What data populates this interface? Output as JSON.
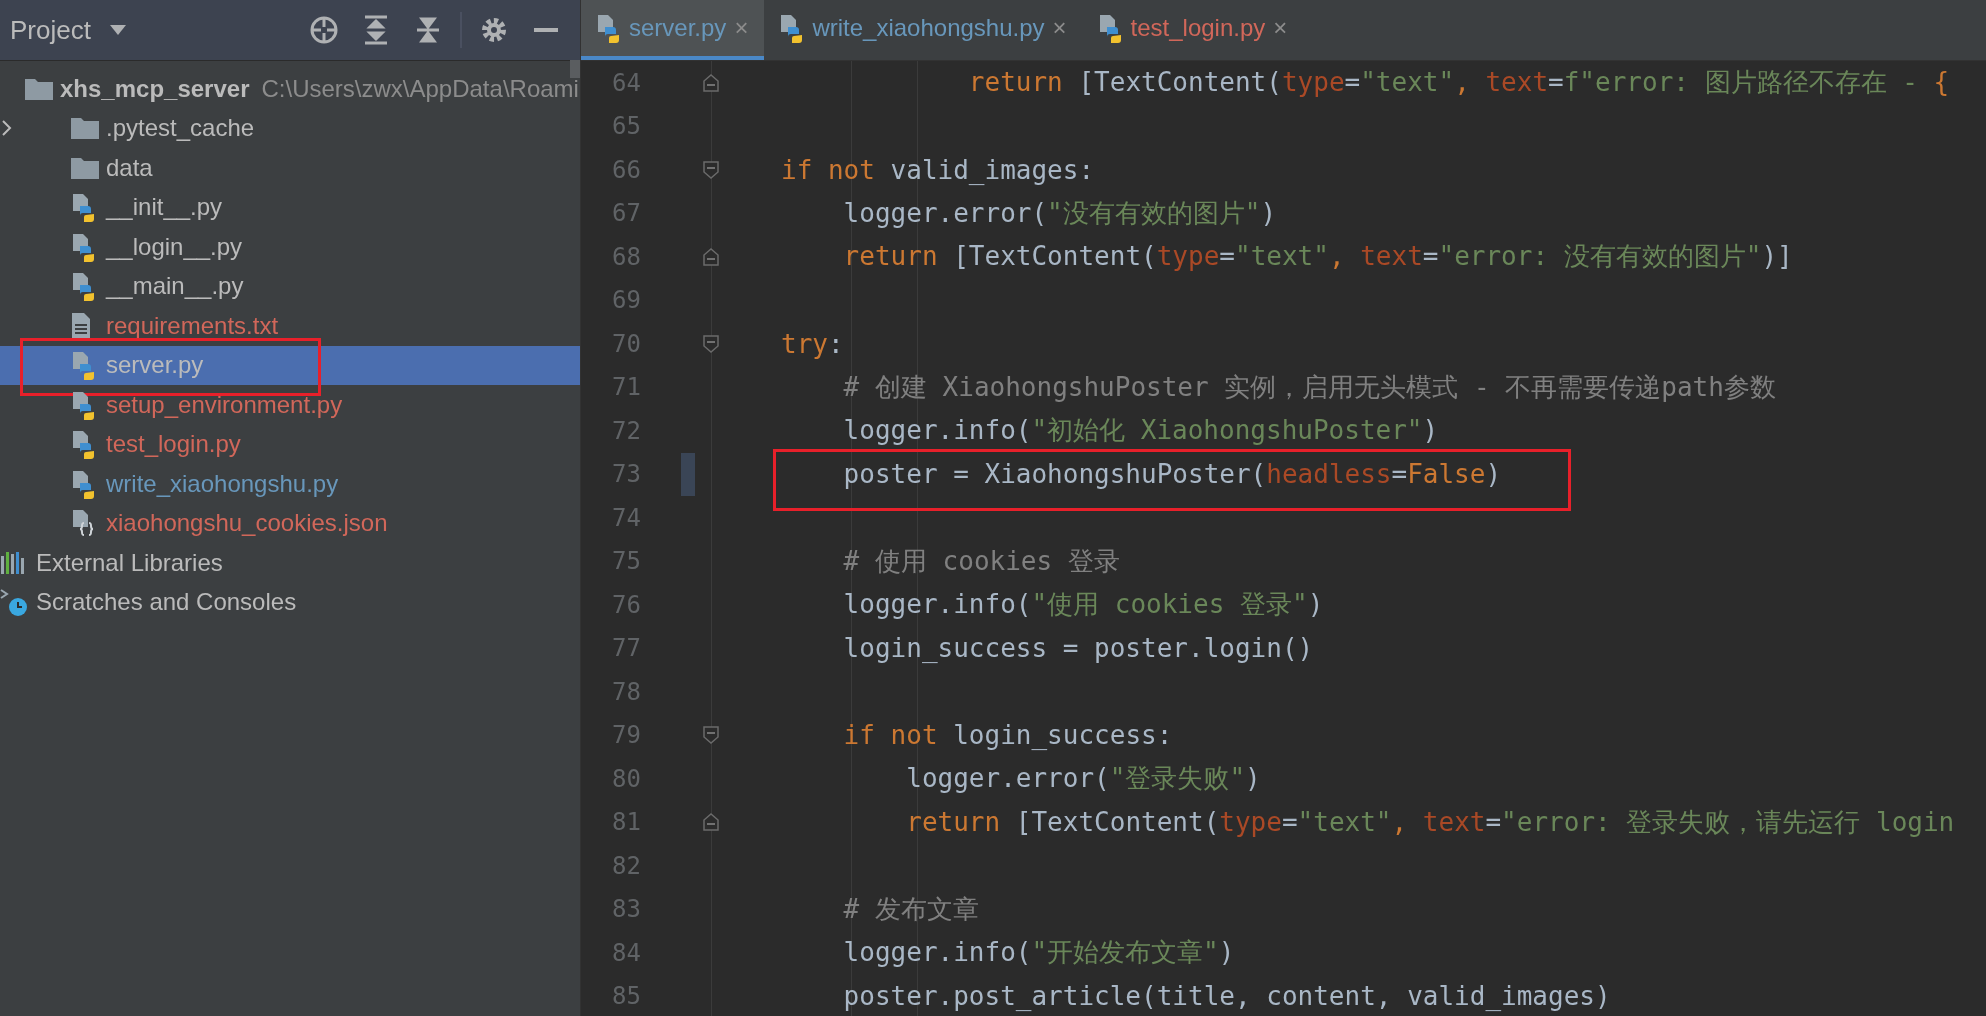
{
  "project_panel": {
    "title": "Project",
    "tree": [
      {
        "label": "xhs_mcp_server",
        "path": "C:\\Users\\zwx\\AppData\\Roami",
        "kind": "root",
        "color": "#bbbbbb",
        "selected": false,
        "children": [
          {
            "label": ".pytest_cache",
            "kind": "folder",
            "color": "#bbbbbb",
            "expanded": false,
            "selected": false
          },
          {
            "label": "data",
            "kind": "folder",
            "color": "#bbbbbb",
            "selected": false
          },
          {
            "label": "__init__.py",
            "kind": "python",
            "color": "#bbbbbb",
            "selected": false
          },
          {
            "label": "__login__.py",
            "kind": "python",
            "color": "#bbbbbb",
            "selected": false
          },
          {
            "label": "__main__.py",
            "kind": "python",
            "color": "#bbbbbb",
            "selected": false
          },
          {
            "label": "requirements.txt",
            "kind": "text",
            "color": "#d1675a",
            "selected": false
          },
          {
            "label": "server.py",
            "kind": "python",
            "color": "#bbbbbb",
            "selected": true,
            "annotated": true
          },
          {
            "label": "setup_environment.py",
            "kind": "python",
            "color": "#d1675a",
            "selected": false
          },
          {
            "label": "test_login.py",
            "kind": "python",
            "color": "#d1675a",
            "selected": false
          },
          {
            "label": "write_xiaohongshu.py",
            "kind": "python",
            "color": "#6897bb",
            "selected": false
          },
          {
            "label": "xiaohongshu_cookies.json",
            "kind": "json",
            "color": "#d1675a",
            "selected": false
          }
        ]
      },
      {
        "label": "External Libraries",
        "kind": "libraries",
        "color": "#bbbbbb",
        "selected": false
      },
      {
        "label": "Scratches and Consoles",
        "kind": "scratches",
        "color": "#bbbbbb",
        "selected": false
      }
    ]
  },
  "editor": {
    "tabs": [
      {
        "label": "server.py",
        "color": "#6897bb",
        "close": "×",
        "selected": true
      },
      {
        "label": "write_xiaohongshu.py",
        "color": "#6897bb",
        "close": "×",
        "selected": false
      },
      {
        "label": "test_login.py",
        "color": "#d1675a",
        "close": "×",
        "selected": false
      }
    ],
    "lines": [
      {
        "number": "64",
        "fold_end": true,
        "tokens": [
          {
            "kind": "keyword",
            "text": "            return"
          },
          {
            "kind": "plain",
            "text": " [TextContent("
          },
          {
            "kind": "param",
            "text": "type"
          },
          {
            "kind": "plain",
            "text": "="
          },
          {
            "kind": "string",
            "text": "\"text\""
          },
          {
            "kind": "keyword",
            "text": ", "
          },
          {
            "kind": "param",
            "text": "text"
          },
          {
            "kind": "plain",
            "text": "="
          },
          {
            "kind": "string",
            "text": "f\"error: 图片路径不存在 - "
          },
          {
            "kind": "keyword",
            "text": "{"
          }
        ]
      },
      {
        "number": "65"
      },
      {
        "number": "66",
        "fold_start": true,
        "tokens": [
          {
            "kind": "keyword",
            "text": "if not"
          },
          {
            "kind": "plain",
            "text": " valid_images:"
          }
        ]
      },
      {
        "number": "67",
        "tokens": [
          {
            "kind": "plain",
            "text": "    logger.error("
          },
          {
            "kind": "string",
            "text": "\"没有有效的图片\""
          },
          {
            "kind": "plain",
            "text": ")"
          }
        ]
      },
      {
        "number": "68",
        "fold_end": true,
        "tokens": [
          {
            "kind": "keyword",
            "text": "    return"
          },
          {
            "kind": "plain",
            "text": " [TextContent("
          },
          {
            "kind": "param",
            "text": "type"
          },
          {
            "kind": "plain",
            "text": "="
          },
          {
            "kind": "string",
            "text": "\"text\""
          },
          {
            "kind": "keyword",
            "text": ", "
          },
          {
            "kind": "param",
            "text": "text"
          },
          {
            "kind": "plain",
            "text": "="
          },
          {
            "kind": "string",
            "text": "\"error: 没有有效的图片\""
          },
          {
            "kind": "plain",
            "text": ")]"
          }
        ]
      },
      {
        "number": "69"
      },
      {
        "number": "70",
        "fold_start": true,
        "tokens": [
          {
            "kind": "keyword",
            "text": "try"
          },
          {
            "kind": "plain",
            "text": ":"
          }
        ]
      },
      {
        "number": "71",
        "tokens": [
          {
            "kind": "comment",
            "text": "    # 创建 XiaohongshuPoster 实例，启用无头模式 - 不再需要传递path参数"
          }
        ]
      },
      {
        "number": "72",
        "tokens": [
          {
            "kind": "plain",
            "text": "    logger.info("
          },
          {
            "kind": "string",
            "text": "\"初始化 XiaohongshuPoster\""
          },
          {
            "kind": "plain",
            "text": ")"
          }
        ]
      },
      {
        "number": "73",
        "annotated": true,
        "tokens": [
          {
            "kind": "plain",
            "text": "    poster = XiaohongshuPoster("
          },
          {
            "kind": "param",
            "text": "headless"
          },
          {
            "kind": "plain",
            "text": "="
          },
          {
            "kind": "keyword",
            "text": "False"
          },
          {
            "kind": "plain",
            "text": ")"
          }
        ]
      },
      {
        "number": "74"
      },
      {
        "number": "75",
        "tokens": [
          {
            "kind": "comment",
            "text": "    # 使用 cookies 登录"
          }
        ]
      },
      {
        "number": "76",
        "tokens": [
          {
            "kind": "plain",
            "text": "    logger.info("
          },
          {
            "kind": "string",
            "text": "\"使用 cookies 登录\""
          },
          {
            "kind": "plain",
            "text": ")"
          }
        ]
      },
      {
        "number": "77",
        "tokens": [
          {
            "kind": "plain",
            "text": "    login_success = poster.login()"
          }
        ]
      },
      {
        "number": "78"
      },
      {
        "number": "79",
        "fold_start": true,
        "tokens": [
          {
            "kind": "keyword",
            "text": "    if not"
          },
          {
            "kind": "plain",
            "text": " login_success:"
          }
        ]
      },
      {
        "number": "80",
        "tokens": [
          {
            "kind": "plain",
            "text": "        logger.error("
          },
          {
            "kind": "string",
            "text": "\"登录失败\""
          },
          {
            "kind": "plain",
            "text": ")"
          }
        ]
      },
      {
        "number": "81",
        "fold_end": true,
        "tokens": [
          {
            "kind": "keyword",
            "text": "        return"
          },
          {
            "kind": "plain",
            "text": " [TextContent("
          },
          {
            "kind": "param",
            "text": "type"
          },
          {
            "kind": "plain",
            "text": "="
          },
          {
            "kind": "string",
            "text": "\"text\""
          },
          {
            "kind": "keyword",
            "text": ", "
          },
          {
            "kind": "param",
            "text": "text"
          },
          {
            "kind": "plain",
            "text": "="
          },
          {
            "kind": "string",
            "text": "\"error: 登录失败，请先运行 login"
          }
        ]
      },
      {
        "number": "82"
      },
      {
        "number": "83",
        "tokens": [
          {
            "kind": "comment",
            "text": "    # 发布文章"
          }
        ]
      },
      {
        "number": "84",
        "tokens": [
          {
            "kind": "plain",
            "text": "    logger.info("
          },
          {
            "kind": "string",
            "text": "\"开始发布文章\""
          },
          {
            "kind": "plain",
            "text": ")"
          }
        ]
      },
      {
        "number": "85",
        "tokens": [
          {
            "kind": "plain",
            "text": "    poster.post_article(title, content, valid_images)"
          }
        ]
      }
    ]
  }
}
